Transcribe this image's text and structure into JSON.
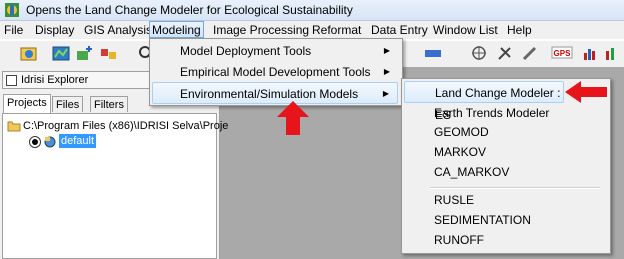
{
  "window": {
    "title": "Opens the Land Change Modeler for Ecological Sustainability"
  },
  "menubar": {
    "items": [
      "File",
      "Display",
      "GIS Analysis",
      "Modeling",
      "Image Processing",
      "Reformat",
      "Data Entry",
      "Window List",
      "Help"
    ],
    "active": "Modeling"
  },
  "explorer": {
    "title": "Idrisi Explorer",
    "tabs": [
      "Projects",
      "Files",
      "Filters"
    ],
    "selected_tab": "Projects",
    "project_path": "C:\\Program Files (x86)\\IDRISI Selva\\Proje",
    "project_name": "default"
  },
  "modeling_menu": {
    "items": [
      {
        "label": "Model Deployment Tools",
        "submenu": true
      },
      {
        "label": "Empirical Model Development Tools",
        "submenu": true
      },
      {
        "label": "Environmental/Simulation Models",
        "submenu": true,
        "highlighted": true
      }
    ]
  },
  "submenu": {
    "items": [
      {
        "label": "Land Change Modeler : ES",
        "highlighted": true
      },
      {
        "label": "Earth Trends Modeler"
      },
      {
        "label": "GEOMOD"
      },
      {
        "label": "MARKOV"
      },
      {
        "label": "CA_MARKOV"
      },
      {
        "label": "RUSLE"
      },
      {
        "label": "SEDIMENTATION"
      },
      {
        "label": "RUNOFF"
      }
    ]
  },
  "colors": {
    "annotation_arrow": "#e8141c",
    "selection": "#3399ff",
    "workspace": "#a9a9a9"
  },
  "icons": [
    "app-icon",
    "open-icon",
    "map-icon",
    "composer-icon",
    "layer-icon",
    "zoom-icon",
    "gps-icon",
    "chart-icon"
  ]
}
